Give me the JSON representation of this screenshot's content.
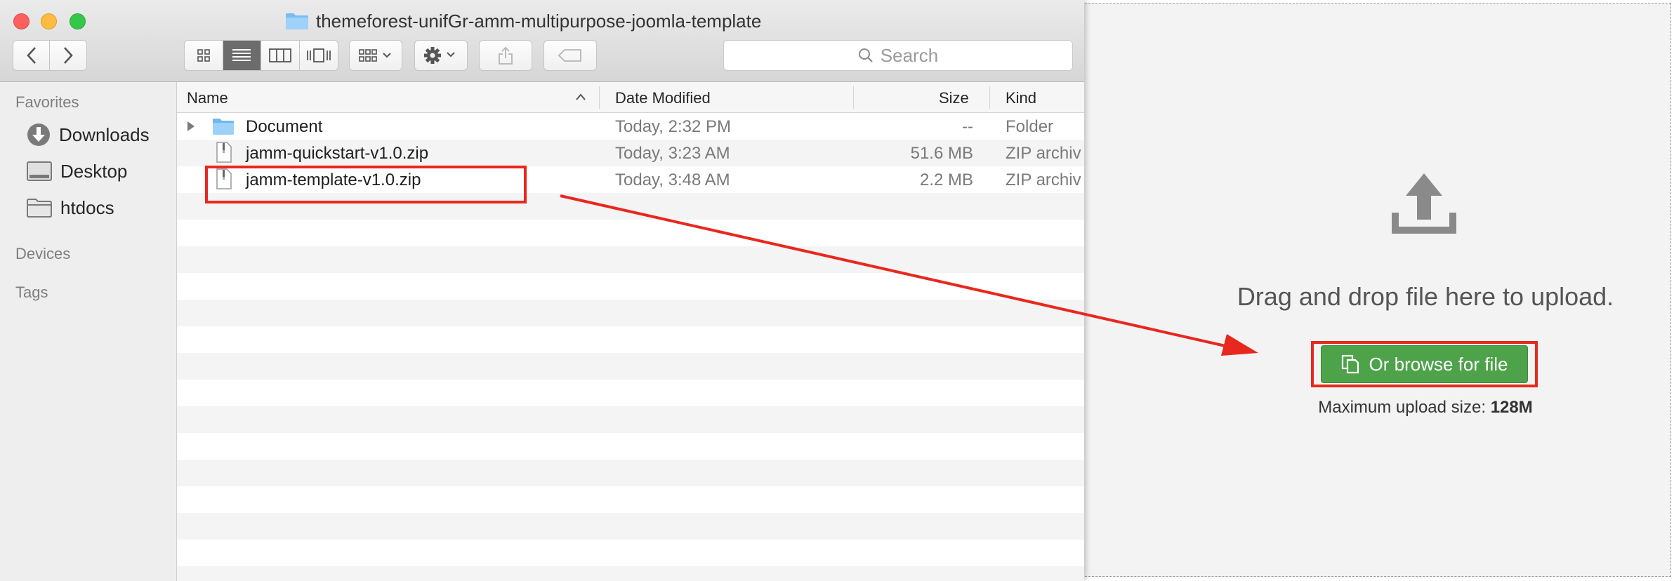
{
  "window": {
    "title": "themeforest-unifGr-amm-multipurpose-joomla-template",
    "search_placeholder": "Search"
  },
  "sidebar": {
    "favorites_label": "Favorites",
    "items": [
      {
        "label": "Downloads",
        "icon": "downloads-icon"
      },
      {
        "label": "Desktop",
        "icon": "desktop-icon"
      },
      {
        "label": "htdocs",
        "icon": "folder-icon"
      }
    ],
    "devices_label": "Devices",
    "tags_label": "Tags"
  },
  "columns": {
    "name": "Name",
    "date": "Date Modified",
    "size": "Size",
    "kind": "Kind"
  },
  "files": [
    {
      "name": "Document",
      "date": "Today, 2:32 PM",
      "size": "--",
      "kind": "Folder",
      "icon": "folder-icon"
    },
    {
      "name": "jamm-quickstart-v1.0.zip",
      "date": "Today, 3:23 AM",
      "size": "51.6 MB",
      "kind": "ZIP archiv",
      "icon": "zip-file-icon"
    },
    {
      "name": "jamm-template-v1.0.zip",
      "date": "Today, 3:48 AM",
      "size": "2.2 MB",
      "kind": "ZIP archiv",
      "icon": "zip-file-icon"
    }
  ],
  "upload": {
    "drop_text": "Drag and drop file here to upload.",
    "browse_label": "Or browse for file",
    "max_label": "Maximum upload size:",
    "max_value": "128M"
  },
  "colors": {
    "annotation": "#e8281e",
    "browse_button": "#4da24a"
  }
}
